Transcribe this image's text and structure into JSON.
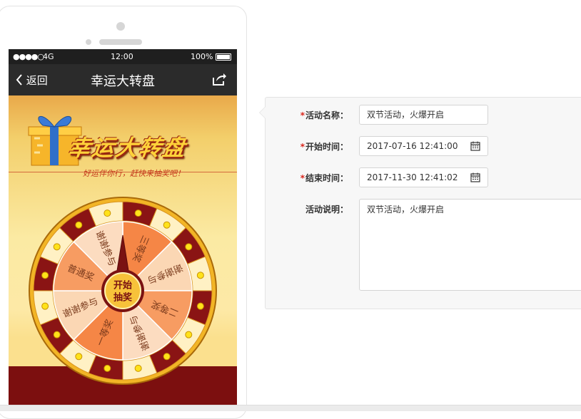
{
  "status": {
    "signal": "●●●●○",
    "network": "4G",
    "time": "12:00",
    "battery": "100%"
  },
  "nav": {
    "back_label": "返回",
    "title": "幸运大转盘"
  },
  "banner": {
    "logo": "幸运大转盘",
    "slogan": "好运伴你行，赶快来抽奖吧！"
  },
  "wheel": {
    "start_label": [
      "开始",
      "抽奖"
    ],
    "sectors": [
      "三等奖",
      "谢谢参与",
      "二等奖",
      "谢谢参与",
      "一等奖",
      "谢谢参与",
      "普通奖",
      "谢谢参与"
    ]
  },
  "form": {
    "name_label": "活动名称：",
    "name_value": "双节活动，火爆开启",
    "start_label": "开始时间：",
    "start_value": "2017-07-16 12:41:00",
    "end_label": "结束时间：",
    "end_value": "2017-11-30 12:41:02",
    "desc_label": "活动说明：",
    "desc_value": "双节活动，火爆开启",
    "required_mark": "*"
  },
  "colors": {
    "accent_red": "#d9261c",
    "navbar": "#2b2b2b",
    "wheel_red": "#8a1414",
    "wheel_orange": "#f48a4c"
  }
}
